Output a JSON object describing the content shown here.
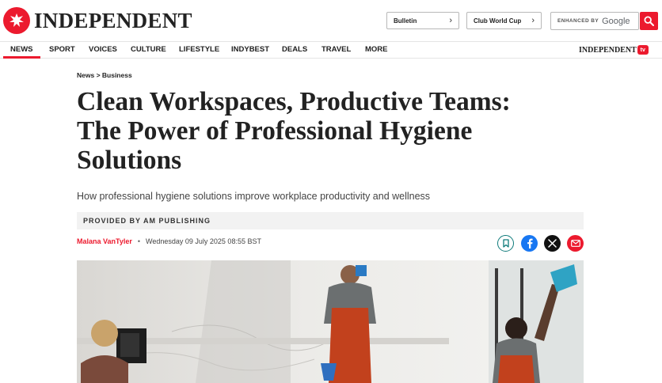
{
  "header": {
    "logo_text": "INDEPENDENT",
    "bulletin_label": "Bulletin",
    "club_world_cup_label": "Club World Cup",
    "search_enhanced": "ENHANCED BY",
    "search_google": "Google"
  },
  "nav": {
    "items": [
      "NEWS",
      "SPORT",
      "VOICES",
      "CULTURE",
      "LIFESTYLE",
      "INDYBEST",
      "DEALS",
      "TRAVEL",
      "MORE"
    ],
    "tv_logo_text": "INDEPENDENT",
    "tv_badge": "tv"
  },
  "article": {
    "breadcrumb": "News > Business",
    "headline_lines": [
      "Clean Workspaces, Productive Teams:",
      "The Power of Professional Hygiene",
      "Solutions"
    ],
    "standfirst": "How professional hygiene solutions improve workplace productivity and wellness",
    "provided_by": "PROVIDED BY AM PUBLISHING",
    "author": "Malana VanTyler",
    "separator": "•",
    "date": "Wednesday 09 July 2025 08:55 BST"
  },
  "icons": [
    "eagle-logo-icon",
    "chevron-right-icon",
    "search-icon",
    "bookmark-icon",
    "facebook-icon",
    "x-icon",
    "email-icon"
  ],
  "colors": {
    "brand_red": "#ec1a2e",
    "facebook_blue": "#1877f2",
    "bookmark_teal": "#0f7b7b"
  }
}
